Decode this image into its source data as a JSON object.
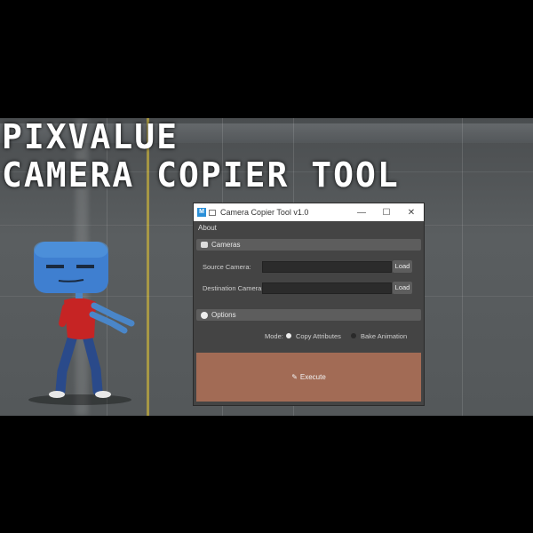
{
  "title_line1": "PIXVALUE",
  "title_line2": "CAMERA COPIER TOOL",
  "window": {
    "title": "Camera Copier Tool v1.0",
    "minimize": "—",
    "maximize": "☐",
    "close": "✕"
  },
  "menu": {
    "about": "About"
  },
  "cameras_section": {
    "header": "Cameras",
    "source_label": "Source Camera:",
    "source_value": "",
    "destination_label": "Destination Camera:",
    "destination_value": "",
    "load_label": "Load"
  },
  "options_section": {
    "header": "Options",
    "mode_label": "Mode:",
    "modes": [
      "Copy Attributes",
      "Bake Animation"
    ],
    "selected_mode": "Copy Attributes"
  },
  "execute_label": "Execute",
  "colors": {
    "execute_bg": "#a26b55",
    "accent_yellow": "#c9b23c"
  }
}
